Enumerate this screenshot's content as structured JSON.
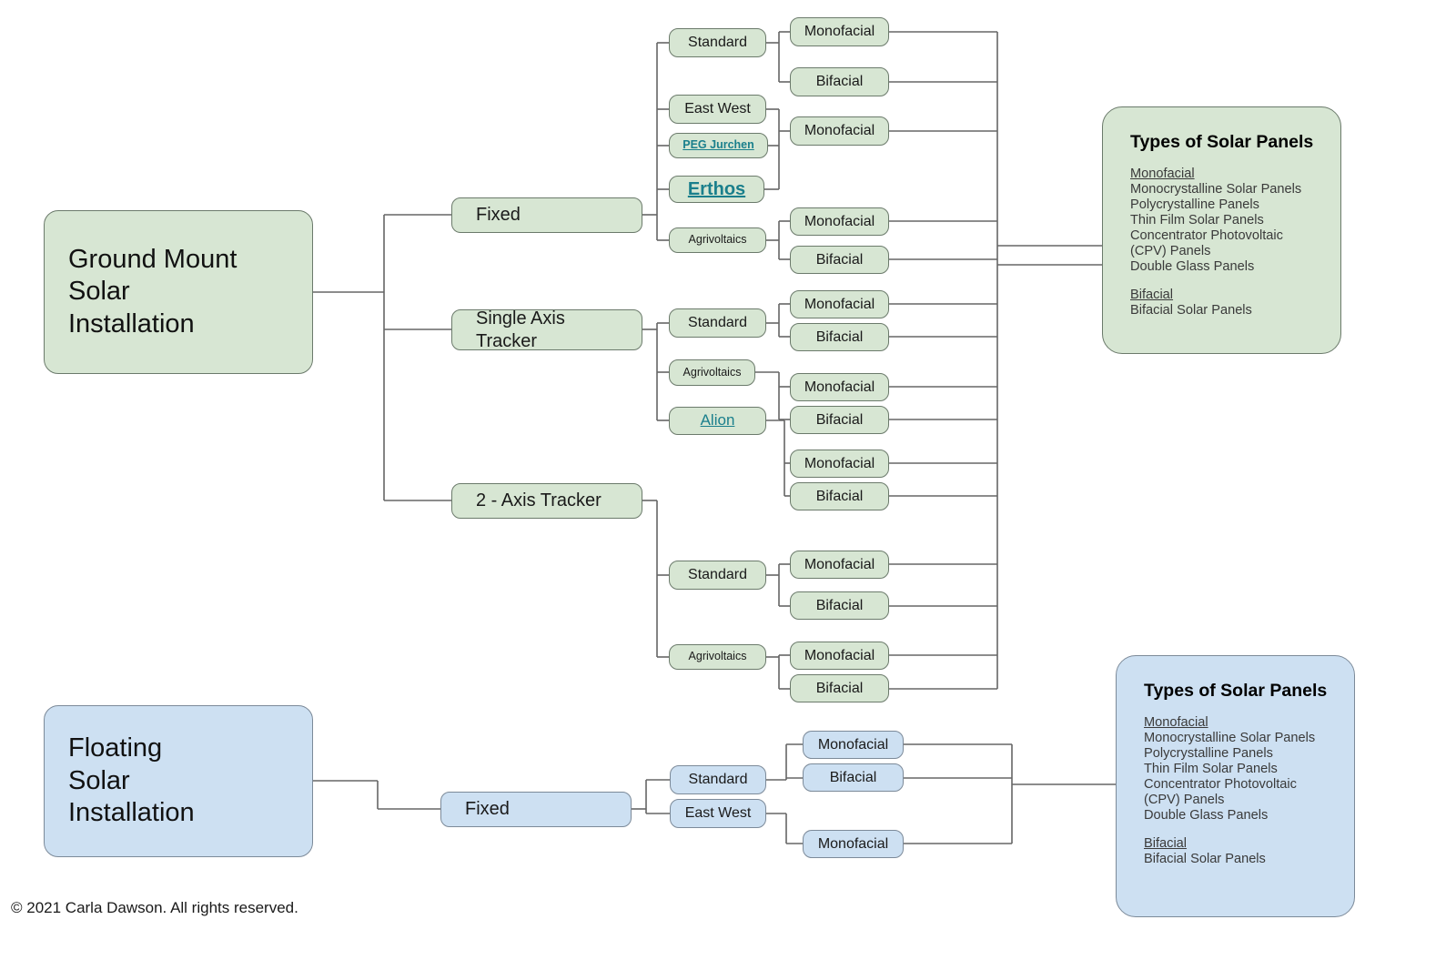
{
  "diagram": {
    "title": "Solar Installation Types Taxonomy",
    "colors": {
      "green_fill": "#d7e6d3",
      "green_stroke": "#6b7a6b",
      "blue_fill": "#cde0f2",
      "blue_stroke": "#7c8a99",
      "link_text": "#1a7f8c",
      "edge_stroke": "#666666",
      "background": "#ffffff"
    }
  },
  "roots": {
    "ground": "Ground Mount\nSolar\nInstallation",
    "floating": "Floating\nSolar\nInstallation"
  },
  "ground_branches": {
    "fixed": "Fixed",
    "single_axis": "Single Axis\nTracker",
    "two_axis": "2 - Axis Tracker"
  },
  "fixed_children": {
    "standard": "Standard",
    "east_west": "East West",
    "peg_jurchen": "PEG Jurchen",
    "erthos": "Erthos",
    "agrivoltaics": "Agrivoltaics"
  },
  "single_axis_children": {
    "standard": "Standard",
    "agrivoltaics": "Agrivoltaics",
    "alion": "Alion"
  },
  "two_axis_children": {
    "standard": "Standard",
    "agrivoltaics": "Agrivoltaics"
  },
  "floating_branches": {
    "fixed": "Fixed"
  },
  "floating_children": {
    "standard": "Standard",
    "east_west": "East West"
  },
  "leaves": {
    "fixed_standard_mono": "Monofacial",
    "fixed_standard_bi": "Bifacial",
    "fixed_ew_group_mono": "Monofacial",
    "fixed_agri_mono": "Monofacial",
    "fixed_agri_bi": "Bifacial",
    "sat_standard_mono": "Monofacial",
    "sat_standard_bi": "Bifacial",
    "sat_agri_mono": "Monofacial",
    "sat_agri_bi": "Bifacial",
    "sat_alion_mono": "Monofacial",
    "sat_alion_bi": "Bifacial",
    "tat_standard_mono": "Monofacial",
    "tat_standard_bi": "Bifacial",
    "tat_agri_mono": "Monofacial",
    "tat_agri_bi": "Bifacial",
    "float_standard_mono": "Monofacial",
    "float_standard_bi": "Bifacial",
    "float_ew_mono": "Monofacial"
  },
  "panel_green": {
    "heading": "Types of Solar\nPanels",
    "mono_label": "Monofacial",
    "mono_items": [
      "Monocrystalline Solar Panels",
      "Polycrystalline Panels",
      "Thin Film Solar Panels",
      "Concentrator Photovoltaic",
      "(CPV) Panels",
      "Double Glass Panels"
    ],
    "bi_label": "Bifacial",
    "bi_items": [
      "Bifacial Solar Panels"
    ]
  },
  "panel_blue": {
    "heading": "Types of Solar\nPanels",
    "mono_label": "Monofacial",
    "mono_items": [
      "Monocrystalline Solar Panels",
      "Polycrystalline Panels",
      "Thin Film Solar Panels",
      "Concentrator Photovoltaic",
      "(CPV) Panels",
      "Double Glass Panels"
    ],
    "bi_label": "Bifacial",
    "bi_items": [
      "Bifacial Solar Panels"
    ]
  },
  "footer": {
    "copyright": "© 2021 Carla Dawson. All rights reserved."
  }
}
